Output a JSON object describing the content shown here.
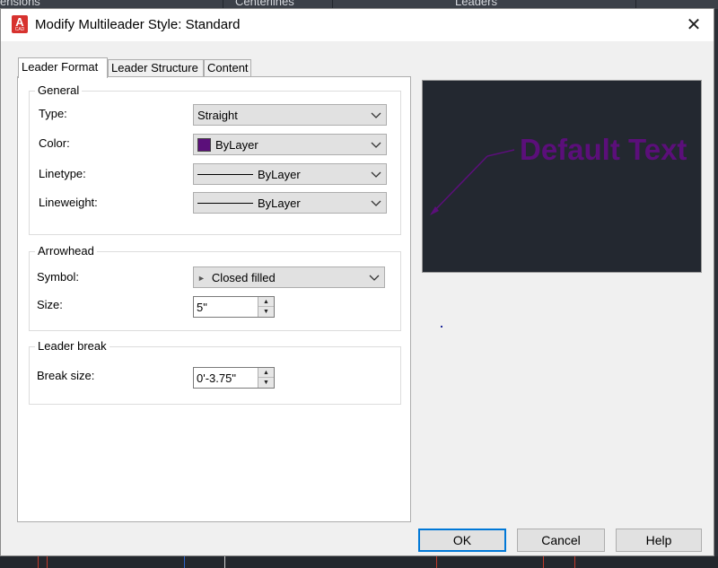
{
  "background": {
    "ribbon_labels": [
      "ensions",
      "Centerlines",
      "Leaders"
    ]
  },
  "dialog": {
    "title": "Modify Multileader Style: Standard",
    "close_glyph": "✕",
    "app_icon": {
      "letter": "A",
      "sub": "CAD",
      "name": "autocad-icon"
    }
  },
  "tabs": [
    {
      "label": "Leader Format",
      "active": true
    },
    {
      "label": "Leader Structure",
      "active": false
    },
    {
      "label": "Content",
      "active": false
    }
  ],
  "general": {
    "title": "General",
    "type_label": "Type:",
    "type_value": "Straight",
    "color_label": "Color:",
    "color_value": "ByLayer",
    "color_swatch": "#5b0f7a",
    "linetype_label": "Linetype:",
    "linetype_value": "ByLayer",
    "lineweight_label": "Lineweight:",
    "lineweight_value": "ByLayer"
  },
  "arrowhead": {
    "title": "Arrowhead",
    "symbol_label": "Symbol:",
    "symbol_value": "Closed filled",
    "symbol_glyph": "►",
    "size_label": "Size:",
    "size_value": "5\""
  },
  "leader_break": {
    "title": "Leader break",
    "break_size_label": "Break size:",
    "break_size_value": "0'-3.75\""
  },
  "preview": {
    "text": "Default Text",
    "text_color": "#5b0f7a",
    "background": "#232830"
  },
  "buttons": {
    "ok": "OK",
    "cancel": "Cancel",
    "help": "Help"
  },
  "spinner": {
    "up": "▲",
    "down": "▼"
  }
}
